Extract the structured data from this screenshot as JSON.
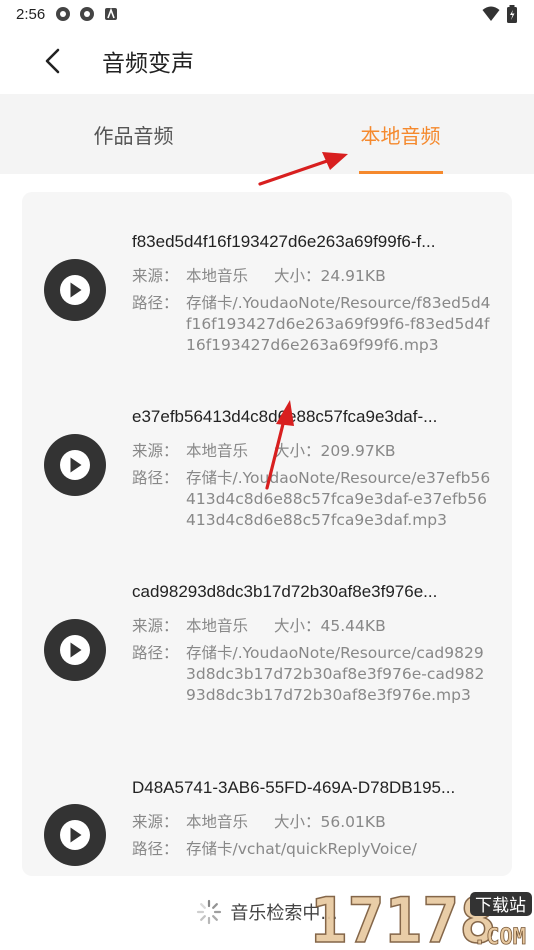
{
  "status_bar": {
    "time": "2:56",
    "left_icons": [
      "notification-icon",
      "notification-icon",
      "app-icon"
    ],
    "right_icons": [
      "wifi-icon",
      "battery-icon"
    ]
  },
  "header": {
    "title": "音频变声",
    "back_icon": "back-arrow-icon"
  },
  "tabs": [
    {
      "label": "作品音频",
      "active": false
    },
    {
      "label": "本地音频",
      "active": true
    }
  ],
  "labels": {
    "source": "来源：",
    "size": "大小：",
    "path": "路径："
  },
  "items": [
    {
      "title": "f83ed5d4f16f193427d6e263a69f99f6-f...",
      "source": "本地音乐",
      "size": "24.91KB",
      "path": "存储卡/.YoudaoNote/Resource/f83ed5d4f16f193427d6e263a69f99f6-f83ed5d4f16f193427d6e263a69f99f6.mp3"
    },
    {
      "title": "e37efb56413d4c8d6e88c57fca9e3daf-...",
      "source": "本地音乐",
      "size": "209.97KB",
      "path": "存储卡/.YoudaoNote/Resource/e37efb56413d4c8d6e88c57fca9e3daf-e37efb56413d4c8d6e88c57fca9e3daf.mp3"
    },
    {
      "title": "cad98293d8dc3b17d72b30af8e3f976e...",
      "source": "本地音乐",
      "size": "45.44KB",
      "path": "存储卡/.YoudaoNote/Resource/cad98293d8dc3b17d72b30af8e3f976e-cad98293d8dc3b17d72b30af8e3f976e.mp3"
    },
    {
      "title": "D48A5741-3AB6-55FD-469A-D78DB195...",
      "source": "本地音乐",
      "size": "56.01KB",
      "path": "存储卡/vchat/quickReplyVoice/"
    }
  ],
  "footer": {
    "loading_text": "音乐检索中..."
  },
  "watermark": {
    "text": "17178",
    "badge": "下载站",
    "suffix": ".COM"
  },
  "colors": {
    "accent": "#f5892d",
    "arrow": "#d81f1f",
    "play_bg": "#333333"
  }
}
